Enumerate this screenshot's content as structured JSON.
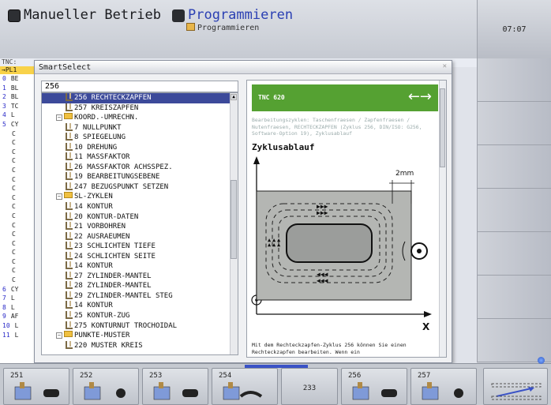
{
  "header": {
    "mode_manual": "Manueller Betrieb",
    "mode_program": "Programmieren",
    "mode_program_sub": "Programmieren",
    "clock": "07:07"
  },
  "background": {
    "path_prefix": "TNC:",
    "top_line": "→PL1",
    "left_list": [
      {
        "num": "0",
        "text": "BE"
      },
      {
        "num": "1",
        "text": "BL"
      },
      {
        "num": "2",
        "text": "BL"
      },
      {
        "num": "3",
        "text": "TC"
      },
      {
        "num": "4",
        "text": "L"
      },
      {
        "num": "5",
        "text": "CY"
      },
      {
        "num": "",
        "text": "C"
      },
      {
        "num": "",
        "text": "C"
      },
      {
        "num": "",
        "text": "C"
      },
      {
        "num": "",
        "text": "C"
      },
      {
        "num": "",
        "text": "C"
      },
      {
        "num": "",
        "text": "C"
      },
      {
        "num": "",
        "text": "C"
      },
      {
        "num": "",
        "text": "C"
      },
      {
        "num": "",
        "text": "C"
      },
      {
        "num": "",
        "text": "C"
      },
      {
        "num": "",
        "text": "C"
      },
      {
        "num": "",
        "text": "C"
      },
      {
        "num": "",
        "text": "C"
      },
      {
        "num": "",
        "text": "C"
      },
      {
        "num": "",
        "text": "C"
      },
      {
        "num": "",
        "text": "C"
      },
      {
        "num": "",
        "text": "C"
      },
      {
        "num": "6",
        "text": "CY"
      },
      {
        "num": "7",
        "text": "L"
      },
      {
        "num": "8",
        "text": "L"
      },
      {
        "num": "9",
        "text": "AF"
      },
      {
        "num": "10",
        "text": "L"
      },
      {
        "num": "11",
        "text": "L"
      }
    ]
  },
  "dialog": {
    "title": "SmartSelect",
    "close": "✕",
    "search_value": "256",
    "tree": [
      {
        "level": 1,
        "type": "cycle",
        "label": "256 RECHTECKZAPFEN",
        "selected": true
      },
      {
        "level": 1,
        "type": "cycle",
        "label": "257 KREISZAPFEN"
      },
      {
        "level": 0,
        "type": "folder",
        "label": "KOORD.-UMRECHN."
      },
      {
        "level": 1,
        "type": "cycle",
        "label": "7 NULLPUNKT"
      },
      {
        "level": 1,
        "type": "cycle",
        "label": "8 SPIEGELUNG"
      },
      {
        "level": 1,
        "type": "cycle",
        "label": "10 DREHUNG"
      },
      {
        "level": 1,
        "type": "cycle",
        "label": "11 MASSFAKTOR"
      },
      {
        "level": 1,
        "type": "cycle",
        "label": "26 MASSFAKTOR ACHSSPEZ."
      },
      {
        "level": 1,
        "type": "cycle",
        "label": "19 BEARBEITUNGSEBENE"
      },
      {
        "level": 1,
        "type": "cycle",
        "label": "247 BEZUGSPUNKT SETZEN"
      },
      {
        "level": 0,
        "type": "folder",
        "label": "SL-ZYKLEN"
      },
      {
        "level": 1,
        "type": "cycle",
        "label": "14 KONTUR"
      },
      {
        "level": 1,
        "type": "cycle",
        "label": "20 KONTUR-DATEN"
      },
      {
        "level": 1,
        "type": "cycle",
        "label": "21 VORBOHREN"
      },
      {
        "level": 1,
        "type": "cycle",
        "label": "22 AUSRAEUMEN"
      },
      {
        "level": 1,
        "type": "cycle",
        "label": "23 SCHLICHTEN TIEFE"
      },
      {
        "level": 1,
        "type": "cycle",
        "label": "24 SCHLICHTEN SEITE"
      },
      {
        "level": 1,
        "type": "cycle",
        "label": "14 KONTUR"
      },
      {
        "level": 1,
        "type": "cycle",
        "label": "27 ZYLINDER-MANTEL"
      },
      {
        "level": 1,
        "type": "cycle",
        "label": "28 ZYLINDER-MANTEL"
      },
      {
        "level": 1,
        "type": "cycle",
        "label": "29 ZYLINDER-MANTEL STEG"
      },
      {
        "level": 1,
        "type": "cycle",
        "label": "14 KONTUR"
      },
      {
        "level": 1,
        "type": "cycle",
        "label": "25 KONTUR-ZUG"
      },
      {
        "level": 1,
        "type": "cycle",
        "label": "275 KONTURNUT TROCHOIDAL"
      },
      {
        "level": 0,
        "type": "folder",
        "label": "PUNKTE-MUSTER"
      },
      {
        "level": 1,
        "type": "cycle",
        "label": "220 MUSTER KREIS"
      }
    ],
    "help": {
      "header_label": "TNC 620",
      "header_arrows": "←→",
      "description": "Bearbeitungszyklen: Taschenfraesen / Zapfenfraesen / Nutenfraesen, RECHTECKZAPFEN (Zyklus 256, DIN/ISO: G256, Software-Option 19), Zyklusablauf",
      "section_title": "Zyklusablauf",
      "dim_label": "2mm",
      "x_axis_label": "X",
      "footer": "Mit dem Rechteckzapfen-Zyklus 256 können Sie einen Rechteckzapfen bearbeiten. Wenn ein"
    }
  },
  "softkeys_bottom": [
    {
      "label": "251"
    },
    {
      "label": "252"
    },
    {
      "label": "253"
    },
    {
      "label": "254"
    },
    {
      "label": "233"
    },
    {
      "label": "256"
    },
    {
      "label": "257"
    },
    {
      "label": ""
    }
  ]
}
